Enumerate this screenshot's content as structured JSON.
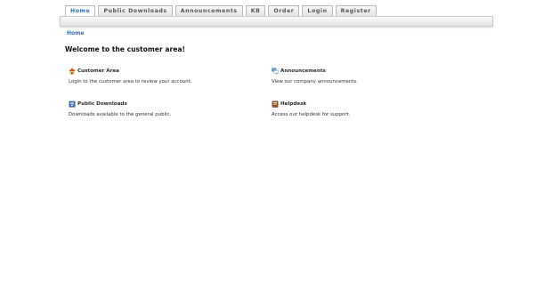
{
  "nav": {
    "tabs": [
      "Home",
      "Public Downloads",
      "Announcements",
      "KB",
      "Order",
      "Login",
      "Register"
    ]
  },
  "breadcrumb": {
    "home": "Home"
  },
  "page_title": "Welcome to the customer area!",
  "sections": {
    "customer_area": {
      "title": "Customer Area",
      "description": "Login to the customer area to review your account.",
      "icon": "house-icon"
    },
    "announcements": {
      "title": "Announcements",
      "description": "View our company announcements.",
      "icon": "speech-bubbles-icon"
    },
    "public_downloads": {
      "title": "Public Downloads",
      "description": "Downloads available to the general public.",
      "icon": "download-box-icon"
    },
    "helpdesk": {
      "title": "Helpdesk",
      "description": "Access our helpdesk for support.",
      "icon": "helpdesk-folder-icon"
    }
  },
  "colors": {
    "link_blue": "#2f6fb5",
    "tab_border": "#b8b8b8",
    "bar_bg": "#e3e3e3"
  }
}
